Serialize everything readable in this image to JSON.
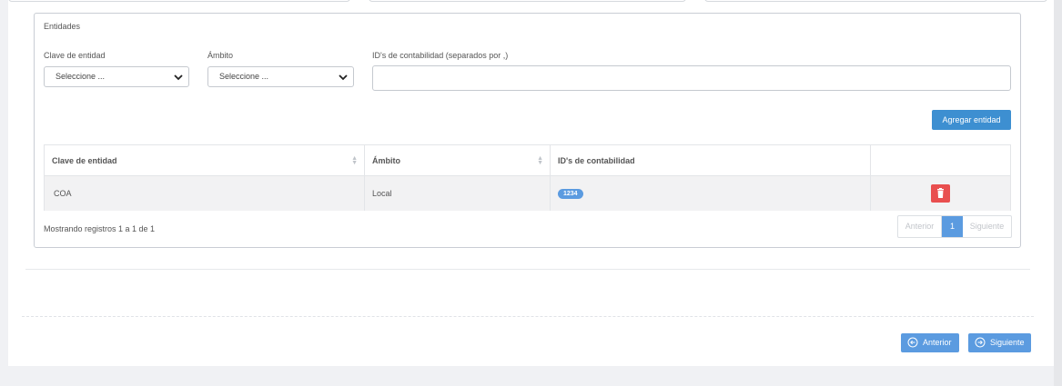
{
  "panel": {
    "title": "Entidades"
  },
  "form": {
    "clave_label": "Clave de entidad",
    "clave_value": "Seleccione ...",
    "ambito_label": "Ámbito",
    "ambito_value": "Seleccione ...",
    "ids_label": "ID's de contabilidad (separados por ,)",
    "ids_value": "",
    "add_button": "Agregar entidad"
  },
  "table": {
    "columns": [
      "Clave de entidad",
      "Ámbito",
      "ID's de contabilidad",
      ""
    ],
    "rows": [
      {
        "clave": "COA",
        "ambito": "Local",
        "ids": [
          "1234"
        ]
      }
    ]
  },
  "footer": {
    "info": "Mostrando registros 1 a 1 de 1",
    "pagination": {
      "prev": "Anterior",
      "current": "1",
      "next": "Siguiente"
    }
  },
  "wizard": {
    "prev_label": "Anterior",
    "next_label": "Siguiente"
  },
  "colors": {
    "primary": "#3d8fd1",
    "light_primary": "#5b9be0",
    "danger": "#e94f4f"
  },
  "icons": {
    "select": "chevron-down-icon",
    "delete": "trash-icon",
    "prev": "arrow-left-circle-icon",
    "next": "arrow-right-circle-icon"
  }
}
